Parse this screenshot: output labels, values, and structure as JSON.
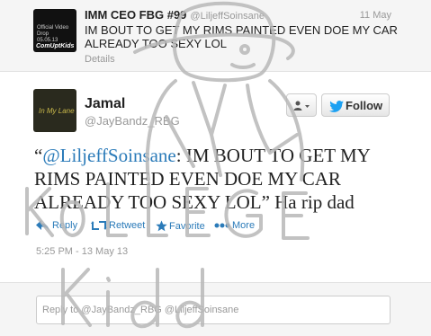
{
  "top_tweet": {
    "avatar_text_1": "Official Video Drop",
    "avatar_text_2": "05.05.13",
    "avatar_text_3": "ComUptKids",
    "name": "IMM CEO FBG #99",
    "handle": "@LiljeffSoinsane",
    "date": "11 May",
    "text": "IM BOUT TO GET MY RIMS PAINTED EVEN DOE MY CAR ALREADY TOO SEXY LOL",
    "details_label": "Details"
  },
  "tweet": {
    "avatar_text": "In My Lane",
    "name": "Jamal",
    "handle": "@JayBandz_RBG",
    "follow_label": "Follow",
    "text_open": "“",
    "text_mention": "@LiljeffSoinsane",
    "text_body": ": IM BOUT TO GET MY RIMS PAINTED EVEN DOE MY CAR ALREADY TOO SEXY LOL” Ha rip dad",
    "timestamp": "5:25 PM - 13 May 13"
  },
  "actions": {
    "reply": "Reply",
    "retweet": "Retweet",
    "favorite": "Favorite",
    "more": "More"
  },
  "reply_box": {
    "placeholder": "Reply to @JayBandz_RBG @LiljeffSoinsane"
  },
  "watermark": {
    "line1": "KOLLEGE",
    "line2": "Kidd"
  },
  "colors": {
    "link": "#2b7bb9",
    "twitter_blue": "#1da1f2",
    "muted": "#999999"
  }
}
